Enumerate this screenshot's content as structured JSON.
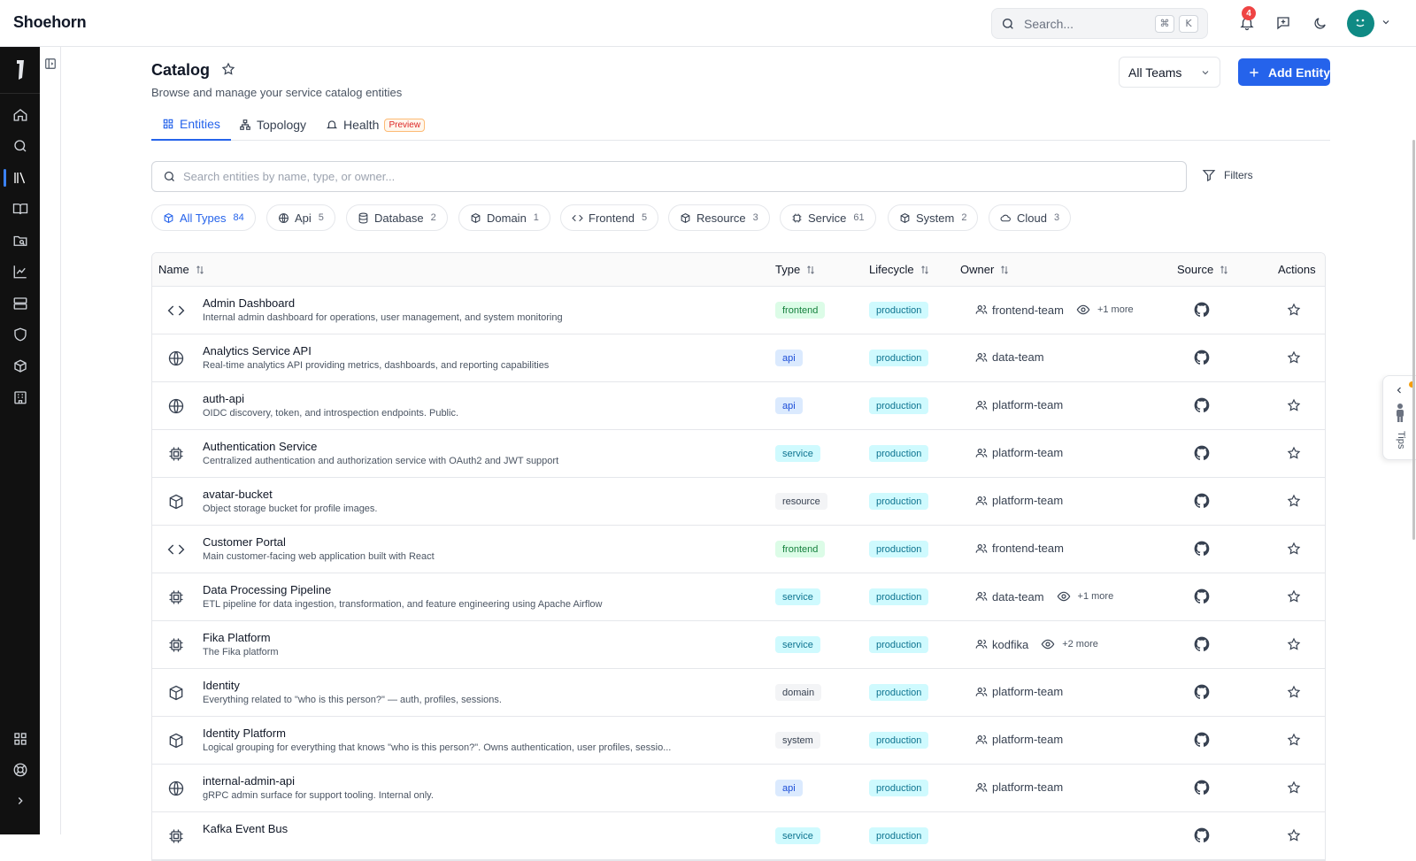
{
  "app": {
    "name": "Shoehorn"
  },
  "topbar": {
    "search_placeholder": "Search...",
    "shortcut_cmd": "⌘",
    "shortcut_key": "K",
    "notification_count": "4"
  },
  "page": {
    "title": "Catalog",
    "subtitle": "Browse and manage your service catalog entities",
    "team_filter": "All Teams",
    "add_label": "Add Entity"
  },
  "tabs": [
    {
      "label": "Entities",
      "icon": "grid-icon",
      "active": true
    },
    {
      "label": "Topology",
      "icon": "hierarchy-icon"
    },
    {
      "label": "Health",
      "icon": "bell-icon",
      "badge": "Preview"
    }
  ],
  "entity_search": {
    "placeholder": "Search entities by name, type, or owner..."
  },
  "filters_label": "Filters",
  "chips": [
    {
      "label": "All Types",
      "count": "84",
      "icon": "cube-icon",
      "active": true
    },
    {
      "label": "Api",
      "count": "5",
      "icon": "globe-icon"
    },
    {
      "label": "Database",
      "count": "2",
      "icon": "database-icon"
    },
    {
      "label": "Domain",
      "count": "1",
      "icon": "cube-icon"
    },
    {
      "label": "Frontend",
      "count": "5",
      "icon": "code-icon"
    },
    {
      "label": "Resource",
      "count": "3",
      "icon": "cube-icon"
    },
    {
      "label": "Service",
      "count": "61",
      "icon": "chip-icon"
    },
    {
      "label": "System",
      "count": "2",
      "icon": "cube-icon"
    },
    {
      "label": "Cloud",
      "count": "3",
      "icon": "cloud-icon"
    }
  ],
  "table": {
    "columns": {
      "name": "Name",
      "type": "Type",
      "lifecycle": "Lifecycle",
      "owner": "Owner",
      "source": "Source",
      "actions": "Actions"
    },
    "rows": [
      {
        "name": "Admin Dashboard",
        "desc": "Internal admin dashboard for operations, user management, and system monitoring",
        "type": "frontend",
        "lifecycle": "production",
        "owner": "frontend-team",
        "more": "+1 more"
      },
      {
        "name": "Analytics Service API",
        "desc": "Real-time analytics API providing metrics, dashboards, and reporting capabilities",
        "type": "api",
        "lifecycle": "production",
        "owner": "data-team",
        "more": ""
      },
      {
        "name": "auth-api",
        "desc": "OIDC discovery, token, and introspection endpoints. Public.",
        "type": "api",
        "lifecycle": "production",
        "owner": "platform-team",
        "more": ""
      },
      {
        "name": "Authentication Service",
        "desc": "Centralized authentication and authorization service with OAuth2 and JWT support",
        "type": "service",
        "lifecycle": "production",
        "owner": "platform-team",
        "more": ""
      },
      {
        "name": "avatar-bucket",
        "desc": "Object storage bucket for profile images.",
        "type": "resource",
        "lifecycle": "production",
        "owner": "platform-team",
        "more": ""
      },
      {
        "name": "Customer Portal",
        "desc": "Main customer-facing web application built with React",
        "type": "frontend",
        "lifecycle": "production",
        "owner": "frontend-team",
        "more": ""
      },
      {
        "name": "Data Processing Pipeline",
        "desc": "ETL pipeline for data ingestion, transformation, and feature engineering using Apache Airflow",
        "type": "service",
        "lifecycle": "production",
        "owner": "data-team",
        "more": "+1 more"
      },
      {
        "name": "Fika Platform",
        "desc": "The Fika platform",
        "type": "service",
        "lifecycle": "production",
        "owner": "kodfika",
        "more": "+2 more"
      },
      {
        "name": "Identity",
        "desc": "Everything related to \"who is this person?\" — auth, profiles, sessions.",
        "type": "domain",
        "lifecycle": "production",
        "owner": "platform-team",
        "more": ""
      },
      {
        "name": "Identity Platform",
        "desc": "Logical grouping for everything that knows \"who is this person?\". Owns authentication, user profiles, sessio...",
        "type": "system",
        "lifecycle": "production",
        "owner": "platform-team",
        "more": ""
      },
      {
        "name": "internal-admin-api",
        "desc": "gRPC admin surface for support tooling. Internal only.",
        "type": "api",
        "lifecycle": "production",
        "owner": "platform-team",
        "more": ""
      },
      {
        "name": "Kafka Event Bus",
        "desc": "",
        "type": "service",
        "lifecycle": "production",
        "owner": "",
        "more": ""
      }
    ]
  },
  "tips_label": "Tips",
  "colors": {
    "accent": "#2563eb",
    "rail": "#111111",
    "avatar": "#0f8a84",
    "badge": "#ef4444"
  }
}
